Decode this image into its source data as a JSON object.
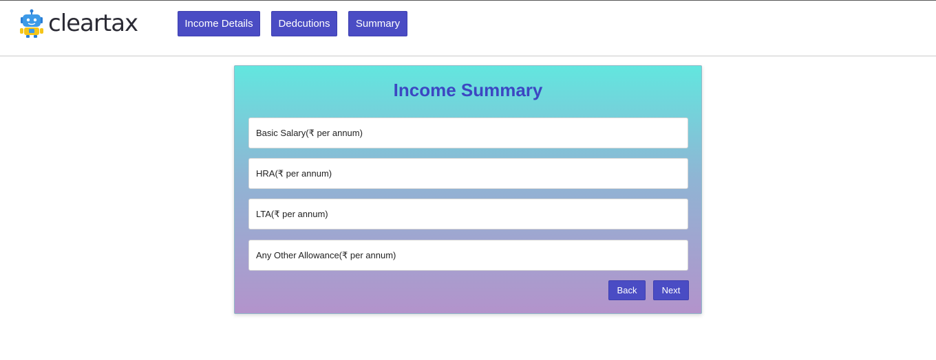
{
  "brand": {
    "name": "cleartax",
    "logo_icon": "robot-mascot-icon"
  },
  "nav": {
    "items": [
      {
        "label": "Income Details"
      },
      {
        "label": "Dedcutions"
      },
      {
        "label": "Summary"
      }
    ]
  },
  "card": {
    "title": "Income Summary",
    "fields": [
      {
        "placeholder": "Basic Salary(₹ per annum)",
        "value": ""
      },
      {
        "placeholder": "HRA(₹ per annum)",
        "value": ""
      },
      {
        "placeholder": "LTA(₹ per annum)",
        "value": ""
      },
      {
        "placeholder": "Any Other Allowance(₹ per annum)",
        "value": ""
      }
    ],
    "back_label": "Back",
    "next_label": "Next"
  },
  "colors": {
    "accent": "#4a4cc4",
    "title": "#3c47c2",
    "gradient_top": "#62e6df",
    "gradient_bottom": "#b393cb"
  }
}
